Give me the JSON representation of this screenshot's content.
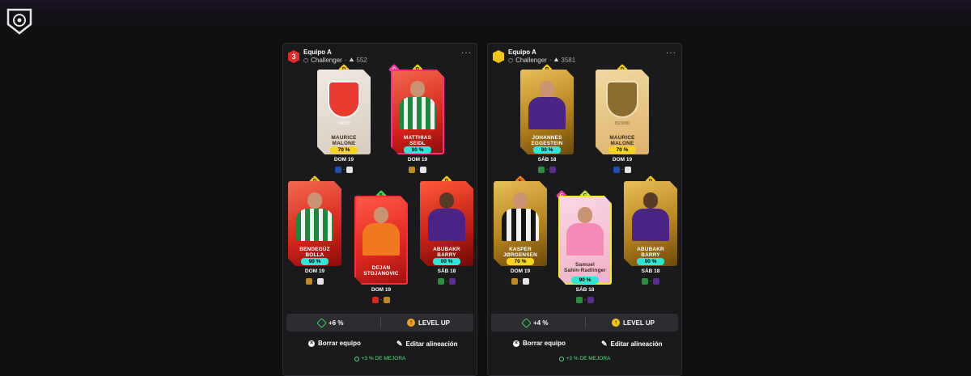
{
  "panels": [
    {
      "level": "3",
      "level_color": "#e02b2b",
      "team_name": "Equipo A",
      "league": "Challenger",
      "score": "552",
      "more": "···",
      "cards": [
        {
          "rarity": "D",
          "frame": "",
          "bg": "greycard",
          "name1": "MAURICE",
          "name2": "MALONE",
          "serial": "14/100",
          "pct": "70 %",
          "pct_style": "yellow",
          "date": "DOM 19"
        },
        {
          "rarity": "D",
          "extra": "C",
          "frame": "frame-pink",
          "bg": "red",
          "name1": "MATTHIAS",
          "name2": "SEIDL",
          "serial": "",
          "pct": "90 %",
          "pct_style": "",
          "date": "DOM 19"
        },
        {
          "rarity": "D",
          "frame": "",
          "bg": "red",
          "name1": "BENDEGÚZ",
          "name2": "BOLLA",
          "serial": "",
          "pct": "90 %",
          "pct_style": "",
          "date": "DOM 19"
        },
        {
          "rarity": "S",
          "frame": "frame-red",
          "bg": "redcard",
          "name1": "DEJAN",
          "name2": "STOJANOVIC",
          "serial": "",
          "pct": "",
          "pct_style": "",
          "date": "DOM 19"
        },
        {
          "rarity": "D",
          "frame": "",
          "bg": "gold",
          "name1": "ABUBAKR",
          "name2": "BARRY",
          "serial": "",
          "pct": "90 %",
          "pct_style": "",
          "date": "SÁB 18"
        }
      ],
      "bonus": "+6 %",
      "level_up": "LEVEL UP",
      "delete_label": "Borrar equipo",
      "edit_label": "Editar alineación",
      "note": "+3 % DE MEJORA"
    },
    {
      "level": "",
      "level_color": "#f0c419",
      "team_name": "Equipo A",
      "league": "Challenger",
      "score": "3581",
      "more": "···",
      "cards": [
        {
          "rarity": "D",
          "frame": "",
          "bg": "gold",
          "name1": "JOHANNES",
          "name2": "EGGESTEIN",
          "serial": "",
          "pct": "90 %",
          "pct_style": "",
          "date": "SÁB 18"
        },
        {
          "rarity": "D",
          "frame": "",
          "bg": "goldcard",
          "name1": "MAURICE",
          "name2": "MALONE",
          "serial": "81/1000",
          "pct": "70 %",
          "pct_style": "yellow",
          "date": "DOM 19"
        },
        {
          "rarity": "E",
          "frame": "",
          "bg": "gold",
          "name1": "KASPER",
          "name2": "JØRGENSEN",
          "serial": "",
          "pct": "70 %",
          "pct_style": "yellow",
          "date": "DOM 19"
        },
        {
          "rarity": "C",
          "extra": "C",
          "frame": "frame-yellow",
          "bg": "pink",
          "name1": "Samuel",
          "name2": "Sahin-Radlinger",
          "serial": "",
          "pct": "90 %",
          "pct_style": "",
          "date": "SÁB 18"
        },
        {
          "rarity": "D",
          "frame": "",
          "bg": "gold",
          "name1": "ABUBAKR",
          "name2": "BARRY",
          "serial": "",
          "pct": "90 %",
          "pct_style": "",
          "date": "SÁB 18"
        }
      ],
      "bonus": "+4 %",
      "level_up": "LEVEL UP",
      "delete_label": "Borrar equipo",
      "edit_label": "Editar alineación",
      "note": "+3 % DE MEJORA"
    }
  ],
  "colors": {
    "background": "#101010",
    "panel": "#1a1a1c",
    "accent_cyan": "#2ee6d6",
    "accent_green": "#5ee27b",
    "accent_gold": "#f0c419"
  },
  "icons": [
    "app-logo-icon",
    "league-icon",
    "score-icon",
    "more-icon",
    "bonus-icon",
    "level-up-icon",
    "close-icon",
    "pencil-icon",
    "boost-icon"
  ]
}
